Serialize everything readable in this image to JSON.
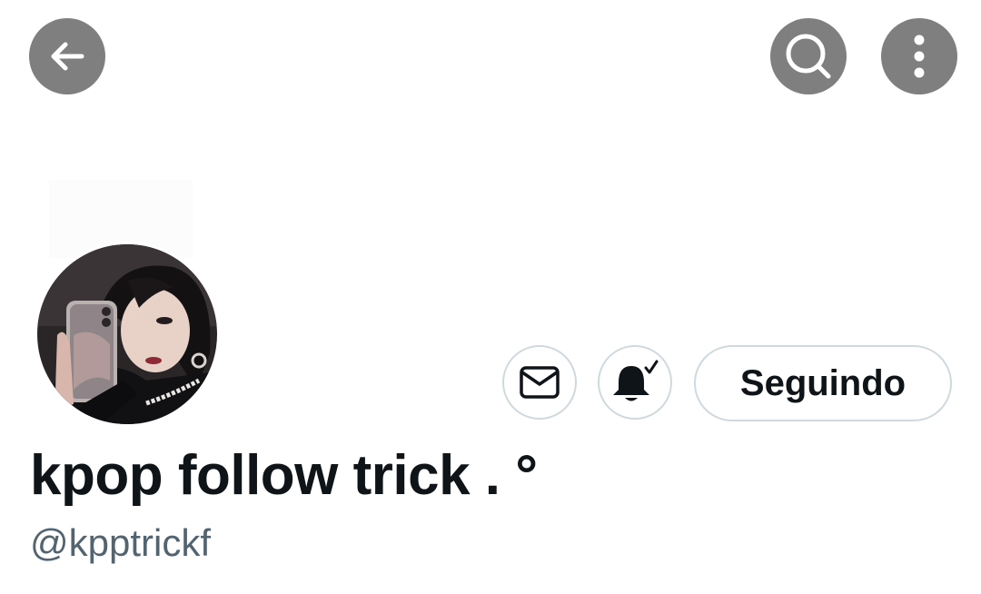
{
  "header": {
    "back_icon": "arrow-left-icon",
    "search_icon": "search-icon",
    "more_icon": "more-vertical-icon"
  },
  "profile": {
    "avatar_description": "profile-photo",
    "display_name": "kpop follow trick . °",
    "handle": "@kpptrickf"
  },
  "actions": {
    "message_icon": "envelope-icon",
    "notifications_icon": "bell-check-icon",
    "following_label": "Seguindo"
  },
  "colors": {
    "header_button_bg": "#7f7f7f",
    "border": "#cfd9de",
    "text_primary": "#0f1419",
    "text_secondary": "#536471"
  }
}
